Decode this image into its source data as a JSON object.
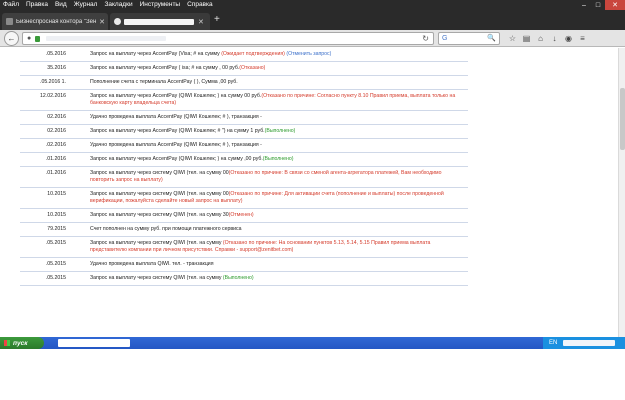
{
  "menu": [
    "Файл",
    "Правка",
    "Вид",
    "Журнал",
    "Закладки",
    "Инструменты",
    "Справка"
  ],
  "window_controls": {
    "minimize": "–",
    "maximize": "□",
    "close": "✕"
  },
  "tabs": {
    "active_title": "Бизнеспросная контора \"Зен…",
    "close": "✕",
    "new_tab": "+"
  },
  "navbar": {
    "back": "←",
    "reload": "↻",
    "search_engine": "G",
    "search_icon": "🔍",
    "icons": [
      "star-icon",
      "bookmarks-icon",
      "home-icon",
      "download-icon",
      "sync-icon",
      "menu-icon"
    ],
    "icon_glyphs": [
      "☆",
      "▤",
      "⌂",
      "↓",
      "◉",
      "≡"
    ]
  },
  "history": [
    {
      "date": ".05.2016",
      "c2": "",
      "text": "Запрос на выплату через AccentPay (Visa; #",
      "tail": " на сумму ",
      "status": "(Ожидает подтверждения) ",
      "status_class": "red",
      "extra": "(Отменить запрос)",
      "extra_class": "blue"
    },
    {
      "date": "35.2016",
      "c2": "",
      "text": "Запрос на выплату через AccentPay (  isa; #",
      "tail": " на сумму  ,  00 руб.",
      "status": "(Отказано)",
      "status_class": "red",
      "extra": "",
      "extra_class": ""
    },
    {
      "date": ".05.2016 1.",
      "c2": "",
      "text": "Пополнение счета с терминала AccentPay (",
      "tail": " ), Сумма  ,00 руб.",
      "status": "",
      "status_class": "",
      "extra": "",
      "extra_class": ""
    },
    {
      "date": "12.02.2016",
      "c2": "",
      "text": "Запрос на выплату через AccentPay (QIWI Кошелек; ",
      "tail": " ) на сумму  00 руб.",
      "status": "(Отказано по причине: Согласно пункту 8.10 Правил приема, выплата только на банковскую карту владельца счета)",
      "status_class": "red",
      "extra": "",
      "extra_class": ""
    },
    {
      "date": "02.2016",
      "c2": "",
      "text": "Удачно проведена выплата AccentPay (QIWI Кошелек; #",
      "tail": " ), транзакция - ",
      "status": "",
      "status_class": "",
      "extra": "",
      "extra_class": ""
    },
    {
      "date": "02.2016",
      "c2": "",
      "text": "Запрос на выплату через AccentPay (QIWI Кошелек; #",
      "tail": " \") на сумму 1  руб.",
      "status": "(Выполнено)",
      "status_class": "green",
      "extra": "",
      "extra_class": ""
    },
    {
      "date": ".02.2016",
      "c2": "",
      "text": "Удачно проведена выплата AccentPay (QIWI Кошелек; #",
      "tail": " ), транзакция - ",
      "status": "",
      "status_class": "",
      "extra": "",
      "extra_class": ""
    },
    {
      "date": ".01.2016",
      "c2": "",
      "text": "Запрос на выплату через AccentPay (QIWI Кошелек; ",
      "tail": " ) на сумму  ,00 руб.",
      "status": "(Выполнено)",
      "status_class": "green",
      "extra": "",
      "extra_class": ""
    },
    {
      "date": ".01.2016",
      "c2": "",
      "text": "Запрос на выплату через систему QIWI (тел. ",
      "tail": " на сумму  00",
      "status": "(Отказано по причине: В связи со сменой агента-агрегатора платежей, Вам необходимо повторить запрос на выплату)",
      "status_class": "red",
      "extra": "",
      "extra_class": ""
    },
    {
      "date": "10.2015",
      "c2": "",
      "text": "Запрос на выплату через систему QIWI (тел. ",
      "tail": " на сумму  00",
      "status": "(Отказано по причине: Для активации счета (пополнение и выплаты) после проведенной верификации, пожалуйста сделайте новый запрос на выплату)",
      "status_class": "red",
      "extra": "",
      "extra_class": ""
    },
    {
      "date": "10.2015",
      "c2": "",
      "text": "Запрос на выплату через систему QIWI (тел. ",
      "tail": " на сумму  30",
      "status": "(Отменен)",
      "status_class": "red",
      "extra": "",
      "extra_class": ""
    },
    {
      "date": "79.2015",
      "c2": "",
      "text": "Счет пополнен на сумму  руб. при помощи платежного сервиса ",
      "tail": "",
      "status": "",
      "status_class": "",
      "extra": "",
      "extra_class": ""
    },
    {
      "date": ".05.2015",
      "c2": "",
      "text": "Запрос на выплату через систему QIWI (тел. ",
      "tail": " на сумму ",
      "status": "(Отказано по причине: На основании пунктов 5.13, 5.14, 5.15 Правил приема выплата представителю компании при личном присутствии. Справки - support@zenitbet.com)",
      "status_class": "red",
      "extra": "",
      "extra_class": ""
    },
    {
      "date": ".05.2015",
      "c2": "",
      "text": "Удачно проведена выплата QIWI. тел. - ",
      "tail": " транзакция ",
      "status": "",
      "status_class": "",
      "extra": "",
      "extra_class": ""
    },
    {
      "date": ".05.2015",
      "c2": "",
      "text": "Запрос на выплату через систему QIWI (тел. ",
      "tail": " на сумму ",
      "status": "(Выполнено)",
      "status_class": "green",
      "extra": "",
      "extra_class": ""
    }
  ],
  "taskbar": {
    "start_label": "пуск",
    "language": "EN"
  }
}
